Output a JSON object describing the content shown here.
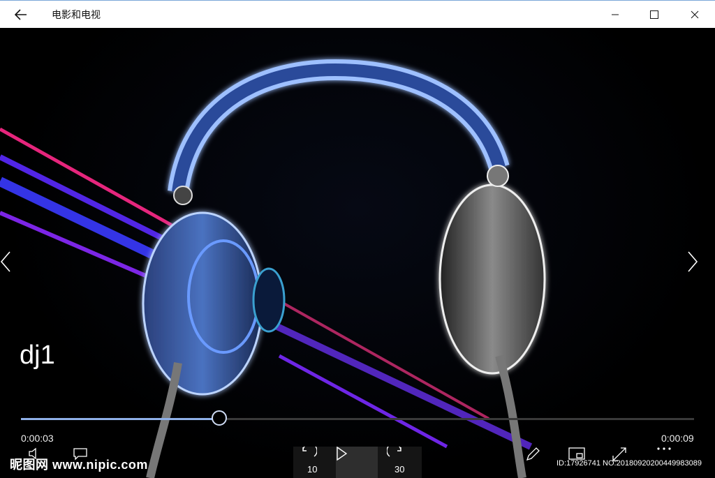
{
  "window": {
    "app_title": "电影和电视",
    "back_icon": "back-arrow-icon",
    "minimize_icon": "minimize-icon",
    "maximize_icon": "maximize-icon",
    "close_icon": "close-icon"
  },
  "player": {
    "video_title": "dj1",
    "elapsed": "0:00:03",
    "total": "0:00:09",
    "progress": 0.295,
    "skip_back": "10",
    "skip_forward": "30",
    "icons": [
      "volume-icon",
      "subtitles-icon",
      "rewind-10-icon",
      "play-icon",
      "forward-30-icon",
      "edit-icon",
      "mini-view-icon",
      "fullscreen-icon",
      "more-icon"
    ]
  },
  "watermark": {
    "left": "昵图网 www.nipic.com",
    "right": "ID:17926741 NO:20180920200449983089"
  },
  "colors": {
    "accent": "#8fb0e8",
    "background": "#000000",
    "titlebar": "#ffffff"
  }
}
